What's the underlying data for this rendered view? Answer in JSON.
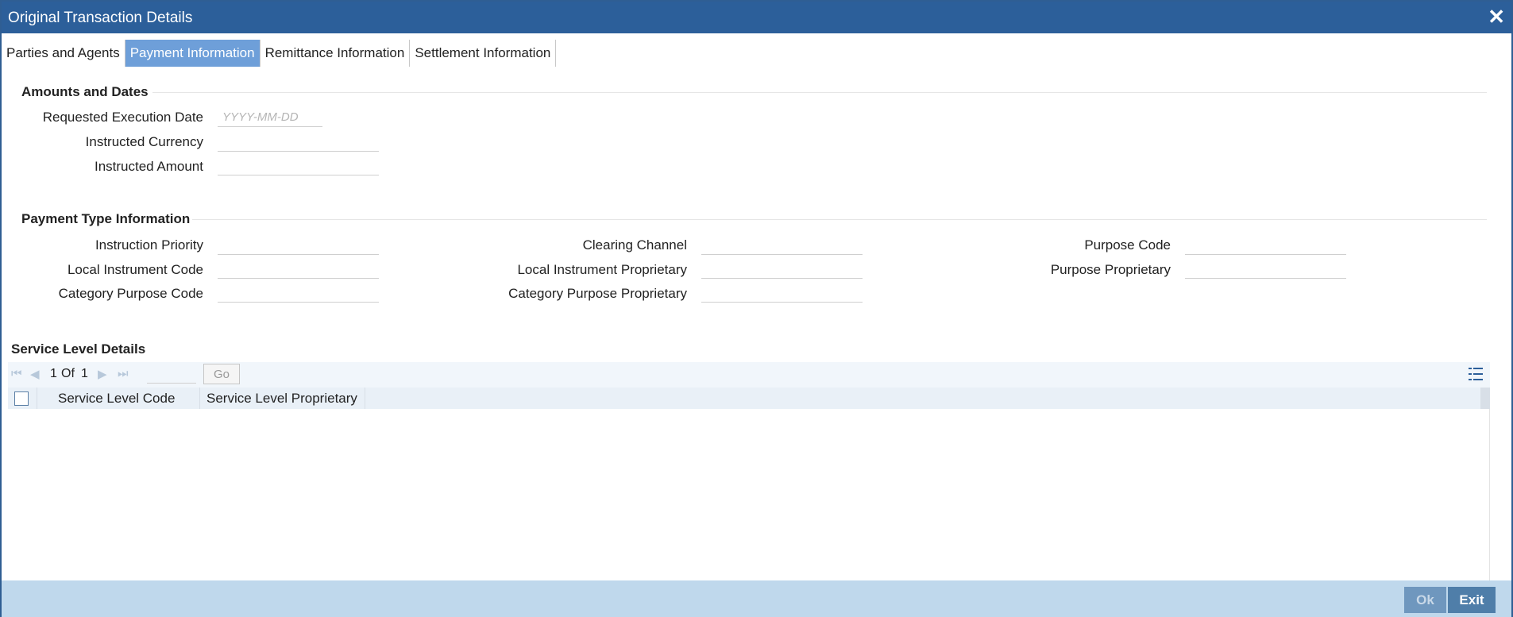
{
  "window": {
    "title": "Original Transaction Details",
    "close_glyph": "✕"
  },
  "tabs": [
    {
      "label": "Parties and Agents",
      "active": false
    },
    {
      "label": "Payment Information",
      "active": true
    },
    {
      "label": "Remittance Information",
      "active": false
    },
    {
      "label": "Settlement Information",
      "active": false
    }
  ],
  "amounts_dates": {
    "title": "Amounts and Dates",
    "requested_execution_date": {
      "label": "Requested Execution Date",
      "value": "",
      "placeholder": "YYYY-MM-DD"
    },
    "instructed_currency": {
      "label": "Instructed Currency",
      "value": ""
    },
    "instructed_amount": {
      "label": "Instructed Amount",
      "value": ""
    }
  },
  "payment_type": {
    "title": "Payment Type Information",
    "instruction_priority": {
      "label": "Instruction Priority",
      "value": ""
    },
    "local_instrument_code": {
      "label": "Local Instrument Code",
      "value": ""
    },
    "category_purpose_code": {
      "label": "Category Purpose Code",
      "value": ""
    },
    "clearing_channel": {
      "label": "Clearing Channel",
      "value": ""
    },
    "local_instrument_proprietary": {
      "label": "Local Instrument Proprietary",
      "value": ""
    },
    "category_purpose_proprietary": {
      "label": "Category Purpose Proprietary",
      "value": ""
    },
    "purpose_code": {
      "label": "Purpose Code",
      "value": ""
    },
    "purpose_proprietary": {
      "label": "Purpose Proprietary",
      "value": ""
    }
  },
  "service_level": {
    "title": "Service Level Details",
    "pager": {
      "current": "1",
      "of_label": "Of",
      "total": "1",
      "go_label": "Go"
    },
    "columns": [
      "Service Level Code",
      "Service Level Proprietary"
    ],
    "rows": []
  },
  "footer": {
    "ok_label": "Ok",
    "exit_label": "Exit"
  },
  "colors": {
    "titlebar": "#2c5f9a",
    "active_tab": "#6e9fd9",
    "footer": "#bfd8ec",
    "exit_button": "#4f7ea9"
  }
}
